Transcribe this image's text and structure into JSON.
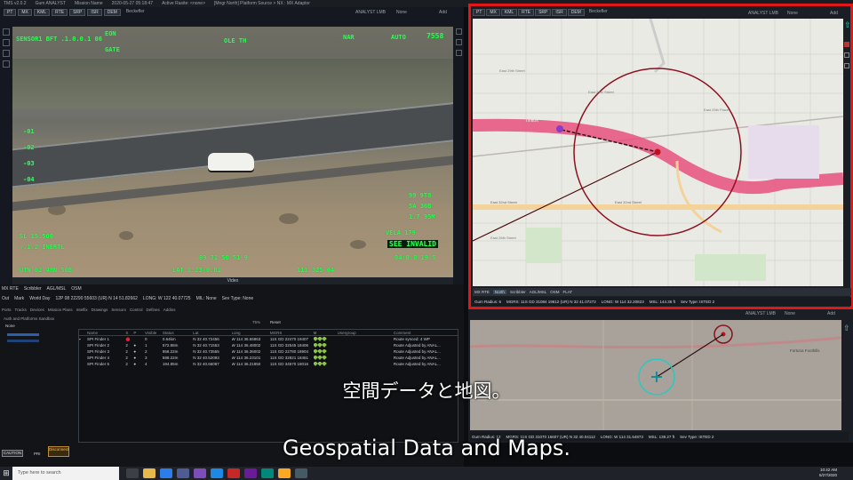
{
  "titlebar": {
    "app": "TMS v2.0.2",
    "user": "Gum ANALYST",
    "mission": "Mission Name",
    "clock": "2020-05-27 05:18:47",
    "active": "Active Rasite: <none>",
    "source": "[Mngr North] Platform Source > NX : MX Adaptor"
  },
  "left_panel": {
    "toolbar": [
      "PT",
      "MX",
      "KML",
      "RTE",
      "SRP",
      "ISR",
      "DEM"
    ],
    "panel_title": "Beckefler",
    "role": "ANALYST LMB",
    "mode": "None",
    "add": "Add",
    "hud": {
      "top_left": "SENSOR1 BFT  .1.0.0.1 06",
      "top_mid1": "EON",
      "top_mid2": "GATE",
      "top_mid3": "OLE TH",
      "top_right_label": "NAR",
      "top_right_auto": "AUTO",
      "top_right_num": "7558",
      "scale": [
        "-01",
        "-02",
        "-03",
        "-04"
      ],
      "right_block": [
        "99 9T8",
        "5A 36B",
        "1.7 95M"
      ],
      "bottom_left": [
        "SL   15.500",
        "-.1.2  INERTL"
      ],
      "bottom_mid": "09 31 50 51 9",
      "bottom_right": [
        "VELA 179",
        "SEE INVALID",
        "04:0.0 19.5"
      ],
      "bottom_row": [
        "UTN 02 48N 50B",
        "LAT  1.23-0.01",
        "111 3Z5  04"
      ]
    },
    "video_label": "Video",
    "status": {
      "mgrs_label": "MGRS:",
      "mgrs": "12P 08 22290 55603 (UR) N 14 51.82662",
      "lng": "LONG: W 122 40.07725",
      "mil": "MIL: None",
      "sev": "Sev Type: None"
    },
    "bottom_tabs": [
      "MX RTE",
      "Scribbler",
      "AGL/MSL",
      "OSM"
    ],
    "toggles": [
      "Out",
      "Mark",
      "World Day"
    ]
  },
  "lower_left": {
    "tabs": [
      "Ports",
      "Tracks",
      "Devices",
      "Mission Plans",
      "Intelfix",
      "Drawings",
      "Sensors",
      "Control",
      "Defines",
      "Addins"
    ],
    "list_title": "Auth and Platforms Sandbox",
    "tree_label": "None",
    "reset": "Reset",
    "zoom": "75%",
    "table_headers": [
      "",
      "Name",
      "S",
      "P",
      "Visible",
      "Status",
      "Lat",
      "Long",
      "MGRS",
      "M",
      "Usergroup",
      "Comment"
    ],
    "rows": [
      {
        "name": "SPI Finder 1",
        "s": "⬤",
        "p": "",
        "vis": "0",
        "status": "0.64km",
        "lat": "N 32 40.72456",
        "long": "W 114 36.65863",
        "mgrs": "11S GD 22470 19407",
        "comment": "Route synced: 4 WP"
      },
      {
        "name": "SPI Finder 2",
        "s": "2",
        "p": "●",
        "vis": "1",
        "status": "572.88m",
        "lat": "N 32 40.71553",
        "long": "W 114 36.48002",
        "mgrs": "11S GD 32545 18406",
        "comment": "Route Adjusted by ANAL..."
      },
      {
        "name": "SPI Finder 3",
        "s": "2",
        "p": "●",
        "vis": "2",
        "status": "958.22m",
        "lat": "N 32 40.73555",
        "long": "W 114 36.36002",
        "mgrs": "11S GD 22780 18904",
        "comment": "Route Adjusted by ANAL..."
      },
      {
        "name": "SPI Finder 4",
        "s": "2",
        "p": "●",
        "vis": "3",
        "status": "598.22m",
        "lat": "N 32 40.52093",
        "long": "W 114 36.23101",
        "mgrs": "11S GD 32821 18461",
        "comment": "Route Adjusted by ANAL..."
      },
      {
        "name": "SPI Finder 5",
        "s": "2",
        "p": "●",
        "vis": "4",
        "status": "194.85m",
        "lat": "N 32 40.66087",
        "long": "W 114 36.21850",
        "mgrs": "11S GD 34570 18016",
        "comment": "Route Adjusted by ANAL..."
      }
    ],
    "caution": "CAUTION",
    "record": "Disconnect",
    "record_sub": "PRI"
  },
  "map_panel": {
    "toolbar": [
      "PT",
      "MX",
      "KML",
      "RTE",
      "SRP",
      "ISR",
      "DEM"
    ],
    "panel_title": "Beckefler",
    "role": "ANALYST LMB",
    "mode": "None",
    "add": "Add",
    "street_labels": [
      "East 32nd Street",
      "East 32nd Street",
      "East 29th Street",
      "East 24th Street",
      "East 25th Place",
      "East 26th Street",
      "I 8 BUS"
    ],
    "foot_tabs": [
      "MX RTE",
      "North",
      "Scribbler",
      "AGL/MSL",
      "OSM",
      "FLAT"
    ],
    "status": {
      "radius": "Gum Radius: 6",
      "mgrs": "MGRS: 11S GD 31084 19612 (UR)  N 32 41.07272",
      "long": "LONG: W 114 32.20823",
      "msl": "MSL: 144.36 ft",
      "sev": "Sev Type: ISTED 2"
    }
  },
  "mini_panel": {
    "role": "ANALYST LMB",
    "mode": "None",
    "add": "Add",
    "place_label": "Fortuna Foothills",
    "status": {
      "radius": "Gum Radius: 12",
      "mgrs": "MGRS: 11S GD 31070 16607 (UR) N 32 40.04112",
      "long": "LONG: W 114 31.64873",
      "msl": "MSL: 139.27 ft",
      "sev": "Sev Type: ISTED 2"
    }
  },
  "subtitles": {
    "jp": "空間データと地図。",
    "en": "Geospatial Data and Maps."
  },
  "taskbar": {
    "search_placeholder": "Type here to search",
    "time": "10:42 AM",
    "date": "5/27/2020"
  },
  "colors": {
    "hud": "#27ff4a",
    "map_border": "#e01818",
    "route": "#e8507c",
    "circle": "#8c1020"
  }
}
